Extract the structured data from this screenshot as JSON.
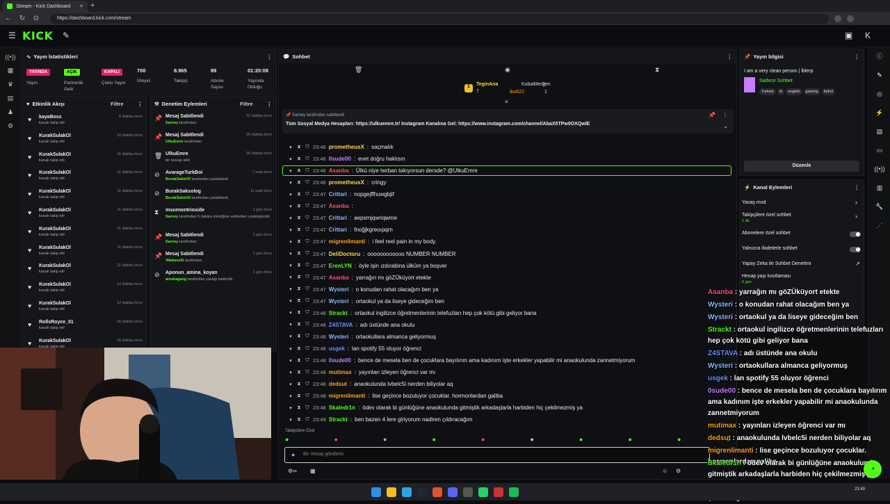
{
  "browser": {
    "tab_title": "Stream - Kick Dashboard",
    "url": "https://dashboard.kick.com/stream"
  },
  "header": {
    "logo": "KICK"
  },
  "stats": {
    "title": "Yayın İstatistikleri",
    "items": [
      {
        "badge": "YAYINDA",
        "label": "Yayın",
        "badge_color": "#e91e63"
      },
      {
        "badge": "AÇIK",
        "label": "Partnerlik Gelir",
        "badge_color": "#53fc18"
      },
      {
        "badge": "KAPALI",
        "label": "Çoklu Yayın",
        "badge_color": "#e91e63"
      },
      {
        "value": "700",
        "label": "İzleyici"
      },
      {
        "value": "8.965",
        "label": "Takipçi"
      },
      {
        "value": "89",
        "label": "Abone Sayısı"
      },
      {
        "value": "01:20:08",
        "label": "Yayında Olduğu"
      }
    ]
  },
  "activity": {
    "title": "Etkinlik Akışı",
    "filter": "Filtre",
    "items": [
      {
        "name": "kayaBoss",
        "sub": "kanalı takip etti",
        "time": "8 dakika önce"
      },
      {
        "name": "KurakSulakOl",
        "sub": "kanalı takip etti",
        "time": "10 dakika önce"
      },
      {
        "name": "KurakSulakOl",
        "sub": "kanalı takip etti",
        "time": "11 dakika önce"
      },
      {
        "name": "KurakSulakOl",
        "sub": "kanalı takip etti",
        "time": "11 dakika önce"
      },
      {
        "name": "KurakSulakOl",
        "sub": "kanalı takip etti",
        "time": "11 dakika önce"
      },
      {
        "name": "KurakSulakOl",
        "sub": "kanalı takip etti",
        "time": "11 dakika önce"
      },
      {
        "name": "KurakSulakOl",
        "sub": "kanalı takip etti",
        "time": "11 dakika önce"
      },
      {
        "name": "KurakSulakOl",
        "sub": "kanalı takip etti",
        "time": "11 dakika önce"
      },
      {
        "name": "KurakSulakOl",
        "sub": "kanalı takip etti",
        "time": "11 dakika önce"
      },
      {
        "name": "KurakSulakOl",
        "sub": "kanalı takip etti",
        "time": "12 dakika önce"
      },
      {
        "name": "KurakSulakOl",
        "sub": "kanalı takip etti",
        "time": "12 dakika önce"
      },
      {
        "name": "RollsRoyce_01",
        "sub": "kanalı takip etti",
        "time": "16 dakika önce"
      },
      {
        "name": "KurakSulakOl",
        "sub": "kanalı takip etti",
        "time": "16 dakika önce"
      }
    ]
  },
  "moderation": {
    "title": "Denetim Eylemleri",
    "filter": "Filtre",
    "items": [
      {
        "icon": "pin-icon",
        "name": "Mesaj Sabitlendi",
        "who": "Sarney",
        "sub": " tarafından",
        "time": "22 dakika önce"
      },
      {
        "icon": "pin-icon",
        "name": "Mesaj Sabitlendi",
        "who": "UlkuEmre",
        "sub": " tarafından",
        "time": "26 dakika önce"
      },
      {
        "icon": "trash-icon",
        "name": "UlkuEmre",
        "who": "",
        "sub": "bir mesajı sildi",
        "time": "36 dakika önce"
      },
      {
        "icon": "ban-icon",
        "name": "AvarageTurkBoi",
        "who": "BurakSakinOl",
        "sub": " tarafından yasaklandı",
        "time": "7 saat önce"
      },
      {
        "icon": "ban-icon",
        "name": "BurakSaksolog",
        "who": "BurakSakinOl",
        "sub": " tarafından yasaklandı",
        "time": "11 saat önce"
      },
      {
        "icon": "hourglass-icon",
        "name": "msxenontrioxide",
        "who": "Sarney",
        "sub": " tarafından 5 dakika süreliğine sohbetten uzaklaştırıldı",
        "time": "1 gün önce"
      },
      {
        "icon": "pin-icon",
        "name": "Mesaj Sabitlendi",
        "who": "Sarney",
        "sub": " tarafından",
        "time": "1 gün önce"
      },
      {
        "icon": "pin-icon",
        "name": "Mesaj Sabitlendi",
        "who": "!Makavelli",
        "sub": " tarafından",
        "time": "1 gün önce"
      },
      {
        "icon": "ban-icon",
        "name": "Aponun_amina_koyan",
        "who": "aloskagang",
        "sub": " tarafından yasağı kaldırıldı",
        "time": "1 gün önce"
      }
    ]
  },
  "chat": {
    "title": "Sohbet",
    "top_viewers": [
      {
        "name": "TeginAna",
        "count": "7"
      },
      {
        "name": "KubaiMergen",
        "count": "2"
      },
      {
        "name": "ibo622",
        "count": "1"
      }
    ],
    "pinned_by": "Sarney",
    "pinned_suffix": "tarafından sabitlendi",
    "pinned_text": "Tüm Sosyal Medya Hesapları: https://ulkuemre.tr/ Instagram Kanalına Gel: https://www.instagram.com/channel/AbaX5TPw0OXQwlE",
    "messages": [
      {
        "time": "23:46",
        "user": "prometheusX",
        "color": "#ffd54a",
        "text": "saçmalık"
      },
      {
        "time": "23:46",
        "user": "0sude00",
        "color": "#c77dff",
        "text": "evet doğru haklısın"
      },
      {
        "time": "23:46",
        "user": "Asanba",
        "color": "#ff4d6d",
        "text": "Ülkü niye twrban takıyorsun dersde? @UlkuEmre"
      },
      {
        "time": "23:46",
        "user": "prometheusX",
        "color": "#ffd54a",
        "text": "cringy"
      },
      {
        "time": "23:47",
        "user": "Crittari",
        "color": "#8ab4ff",
        "text": "nopgejffhuwgbjif"
      },
      {
        "time": "23:47",
        "user": "Asanba",
        "color": "#ff4d6d",
        "text": ""
      },
      {
        "time": "23:47",
        "user": "Crittari",
        "color": "#8ab4ff",
        "text": "aepsmjqwriqwme"
      },
      {
        "time": "23:47",
        "user": "Crittari",
        "color": "#8ab4ff",
        "text": "fnoğjkgreoıpqrn"
      },
      {
        "time": "23:47",
        "user": "migrenlimanti",
        "color": "#ff9f1c",
        "text": "i feel reel pain in my body."
      },
      {
        "time": "23:47",
        "user": "DeliDoctoru",
        "color": "#ffd54a",
        "text": "oooooooooooo NUMBER NUMBER"
      },
      {
        "time": "23:47",
        "user": "ErenLYN",
        "color": "#53fc18",
        "text": "öyle işin ızdırabina ülküm ya boşver"
      },
      {
        "time": "23:47",
        "user": "Asanba",
        "color": "#ff4d6d",
        "text": "yarrağın mı göZÜküyort etekte"
      },
      {
        "time": "23:47",
        "user": "Wysteri",
        "color": "#8ab4ff",
        "text": "o konudan rahat olacağım ben ya"
      },
      {
        "time": "23:47",
        "user": "Wysteri",
        "color": "#8ab4ff",
        "text": "ortaokul ya da liseye gideceğim ben"
      },
      {
        "time": "23:48",
        "user": "Strackt",
        "color": "#53fc18",
        "text": "ortaokul ingilizce öğretmenlerinin telefuzları hep çok kötü gibi geliyor bana"
      },
      {
        "time": "23:48",
        "user": "Z4STAVA",
        "color": "#6c8cff",
        "text": "adı üstünde ana okulu"
      },
      {
        "time": "23:48",
        "user": "Wysteri",
        "color": "#8ab4ff",
        "text": "ortaokullara almanca geliyormuş"
      },
      {
        "time": "23:48",
        "user": "usgek",
        "color": "#6c8cff",
        "text": "lan spotify 55 oluyor öğrenci"
      },
      {
        "time": "23:48",
        "user": "0sude00",
        "color": "#c77dff",
        "text": "bence de mesela ben de çocuklara bayılırım ama kadınım işte erkekler yapabilir mi anaokulunda zannetmiyorum"
      },
      {
        "time": "23:48",
        "user": "mutimax",
        "color": "#ff9f1c",
        "text": "yayınları izleyen öğrenci var mı"
      },
      {
        "time": "23:48",
        "user": "dedsut",
        "color": "#ff9f1c",
        "text": "anaokulunda lvbelc5i nerden biliyolar aq"
      },
      {
        "time": "23:48",
        "user": "migrenlimanti",
        "color": "#ff9f1c",
        "text": "lise geçince bozuluyor çocuklar. hormonlardan galiba"
      },
      {
        "time": "23:48",
        "user": "Skaledr1n",
        "color": "#53fc18",
        "text": "ödev olarak bi günlüğüne anaokulunda gitmiştik arkadaşlarla harbiden hiç çekilmezmiş ya"
      },
      {
        "time": "23:49",
        "user": "Strackt",
        "color": "#53fc18",
        "text": "ben bazen 4 lere giriyorum nadiren çıldıracağım"
      }
    ],
    "followers_label": "Takipçilere Özel",
    "input_placeholder": "Bir mesaj gönderin"
  },
  "stream_info": {
    "title": "Yayın bilgisi",
    "stream_title": "I am a very clean person | lblerp",
    "category": "Sadece Sohbet",
    "tags": [
      "Turkish",
      "irl",
      "english",
      "gaming",
      "futbol"
    ],
    "edit_button": "Düzenle"
  },
  "channel_actions": {
    "title": "Kanal Eylemleri",
    "items": [
      {
        "label": "Yavaş mod"
      },
      {
        "label": "Takipçilere özel sohbet",
        "sub": "1 dk."
      },
      {
        "label": "Abonelere özel sohbet"
      },
      {
        "label": "Yalnızca ifadelerle sohbet"
      },
      {
        "label": "Yapay Zeka ile Sohbet Denetimi"
      },
      {
        "label": "Hesap yaşı kısıtlaması",
        "sub": "5 gün"
      }
    ]
  },
  "overlay": [
    {
      "user": "Asanba",
      "color": "#ff4d6d",
      "text": "yarrağın mı göZÜküyort etekte"
    },
    {
      "user": "Wysteri",
      "color": "#8ab4ff",
      "text": "o konudan rahat olacağım ben ya"
    },
    {
      "user": "Wysteri",
      "color": "#8ab4ff",
      "text": "ortaokul ya da liseye gideceğim ben"
    },
    {
      "user": "Strackt",
      "color": "#53fc18",
      "text": "ortaokul ingilizce öğretmenlerinin telefuzları hep çok kötü gibi geliyor bana"
    },
    {
      "user": "Z4STAVA",
      "color": "#6c8cff",
      "text": "adı üstünde ana okulu"
    },
    {
      "user": "Wysteri",
      "color": "#8ab4ff",
      "text": "ortaokullara almanca geliyormuş"
    },
    {
      "user": "usgek",
      "color": "#6c8cff",
      "text": "lan spotify 55 oluyor öğrenci"
    },
    {
      "user": "0sude00",
      "color": "#c77dff",
      "text": "bence de mesela ben de çocuklara bayılırım ama kadınım işte erkekler yapabilir mi anaokulunda zannetmiyorum"
    },
    {
      "user": "mutimax",
      "color": "#ff9f1c",
      "text": "yayınları izleyen öğrenci var mı"
    },
    {
      "user": "dedsut",
      "color": "#ff9f1c",
      "text": "anaokulunda lvbelc5i nerden biliyolar aq"
    },
    {
      "user": "migrenlimanti",
      "color": "#ff9f1c",
      "text": "lise geçince bozuluyor çocuklar. hormonlardan galiba"
    },
    {
      "user": "Skaledr1n",
      "color": "#53fc18",
      "text": "ödev olarak bi günlüğüne anaokulunda gitmiştik arkadaşlarla harbiden hiç çekilmezmiş ya"
    },
    {
      "user": "Strackt",
      "color": "#53fc18",
      "text": "ben bazen 4 lere giriyorum nadiren çıldıracağım"
    }
  ],
  "taskbar": {
    "time": "23:49"
  },
  "colors": {
    "accent": "#53fc18",
    "live": "#e91e63"
  }
}
